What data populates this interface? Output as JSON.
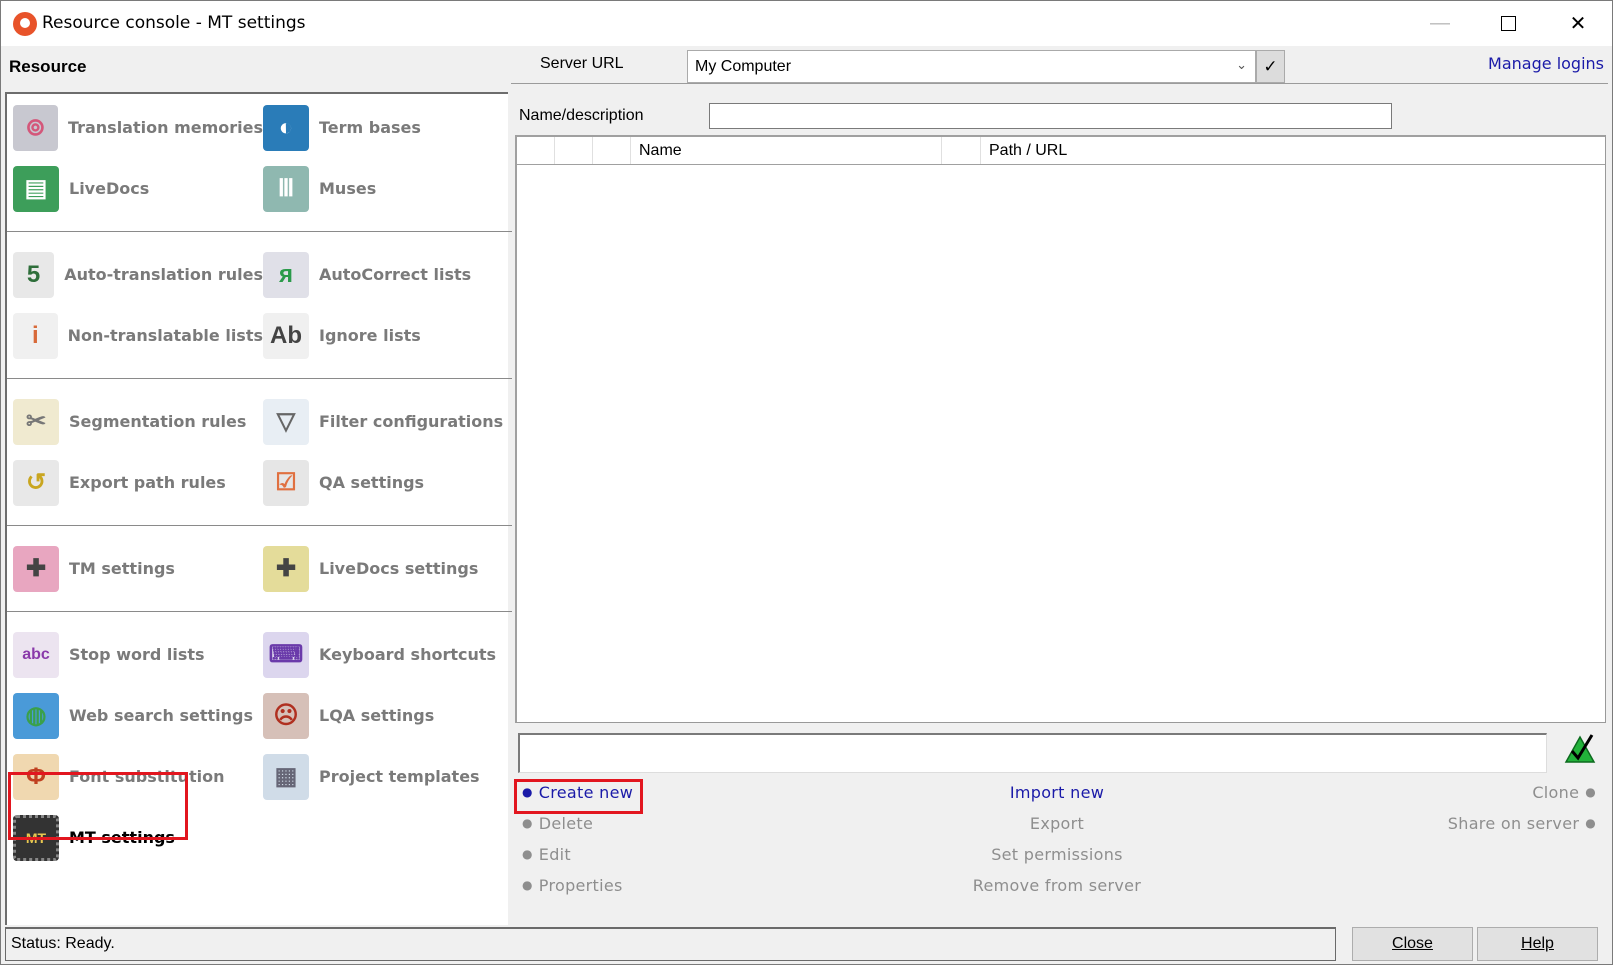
{
  "window": {
    "title": "Resource console - MT settings",
    "minimize_icon": "minimize-icon",
    "maximize_icon": "maximize-icon",
    "close_icon": "close-icon"
  },
  "sidebar": {
    "header": "Resource",
    "groups": [
      [
        {
          "label": "Translation memories",
          "icon": "translation-memories-icon"
        },
        {
          "label": "Term bases",
          "icon": "term-bases-icon"
        },
        {
          "label": "LiveDocs",
          "icon": "livedocs-icon"
        },
        {
          "label": "Muses",
          "icon": "muses-icon"
        }
      ],
      [
        {
          "label": "Auto-translation rules",
          "icon": "auto-translation-rules-icon"
        },
        {
          "label": "AutoCorrect lists",
          "icon": "autocorrect-lists-icon"
        },
        {
          "label": "Non-translatable lists",
          "icon": "non-translatable-lists-icon"
        },
        {
          "label": "Ignore lists",
          "icon": "ignore-lists-icon"
        }
      ],
      [
        {
          "label": "Segmentation rules",
          "icon": "segmentation-rules-icon"
        },
        {
          "label": "Filter configurations",
          "icon": "filter-configurations-icon"
        },
        {
          "label": "Export path rules",
          "icon": "export-path-rules-icon"
        },
        {
          "label": "QA settings",
          "icon": "qa-settings-icon"
        }
      ],
      [
        {
          "label": "TM settings",
          "icon": "tm-settings-icon"
        },
        {
          "label": "LiveDocs settings",
          "icon": "livedocs-settings-icon"
        }
      ],
      [
        {
          "label": "Stop word lists",
          "icon": "stop-word-lists-icon"
        },
        {
          "label": "Keyboard shortcuts",
          "icon": "keyboard-shortcuts-icon"
        },
        {
          "label": "Web search settings",
          "icon": "web-search-settings-icon"
        },
        {
          "label": "LQA settings",
          "icon": "lqa-settings-icon"
        },
        {
          "label": "Font substitution",
          "icon": "font-substitution-icon"
        },
        {
          "label": "Project templates",
          "icon": "project-templates-icon"
        },
        {
          "label": "MT settings",
          "icon": "mt-settings-icon",
          "active": true
        }
      ]
    ]
  },
  "server": {
    "label": "Server URL",
    "selected": "My Computer",
    "ok_symbol": "✓",
    "manage_logins": "Manage logins"
  },
  "filter": {
    "label": "Name/description",
    "value": ""
  },
  "table": {
    "columns": [
      "",
      "",
      "",
      "Name",
      "",
      "Path / URL"
    ],
    "rows": []
  },
  "description": {
    "value": ""
  },
  "actions": {
    "left": [
      {
        "label": "Create new",
        "enabled": true
      },
      {
        "label": "Delete",
        "enabled": false
      },
      {
        "label": "Edit",
        "enabled": false
      },
      {
        "label": "Properties",
        "enabled": false
      }
    ],
    "center": [
      {
        "label": "Import new",
        "enabled": true
      },
      {
        "label": "Export",
        "enabled": false
      },
      {
        "label": "Set permissions",
        "enabled": false
      },
      {
        "label": "Remove from server",
        "enabled": false
      }
    ],
    "right": [
      {
        "label": "Clone",
        "enabled": false
      },
      {
        "label": "Share on server",
        "enabled": false
      }
    ]
  },
  "status": {
    "text": "Status: Ready."
  },
  "buttons": {
    "close": "Close",
    "help": "Help"
  },
  "colors": {
    "link": "#1a1aa8",
    "disabled": "#8e8e8e",
    "highlight": "#e2161f"
  }
}
